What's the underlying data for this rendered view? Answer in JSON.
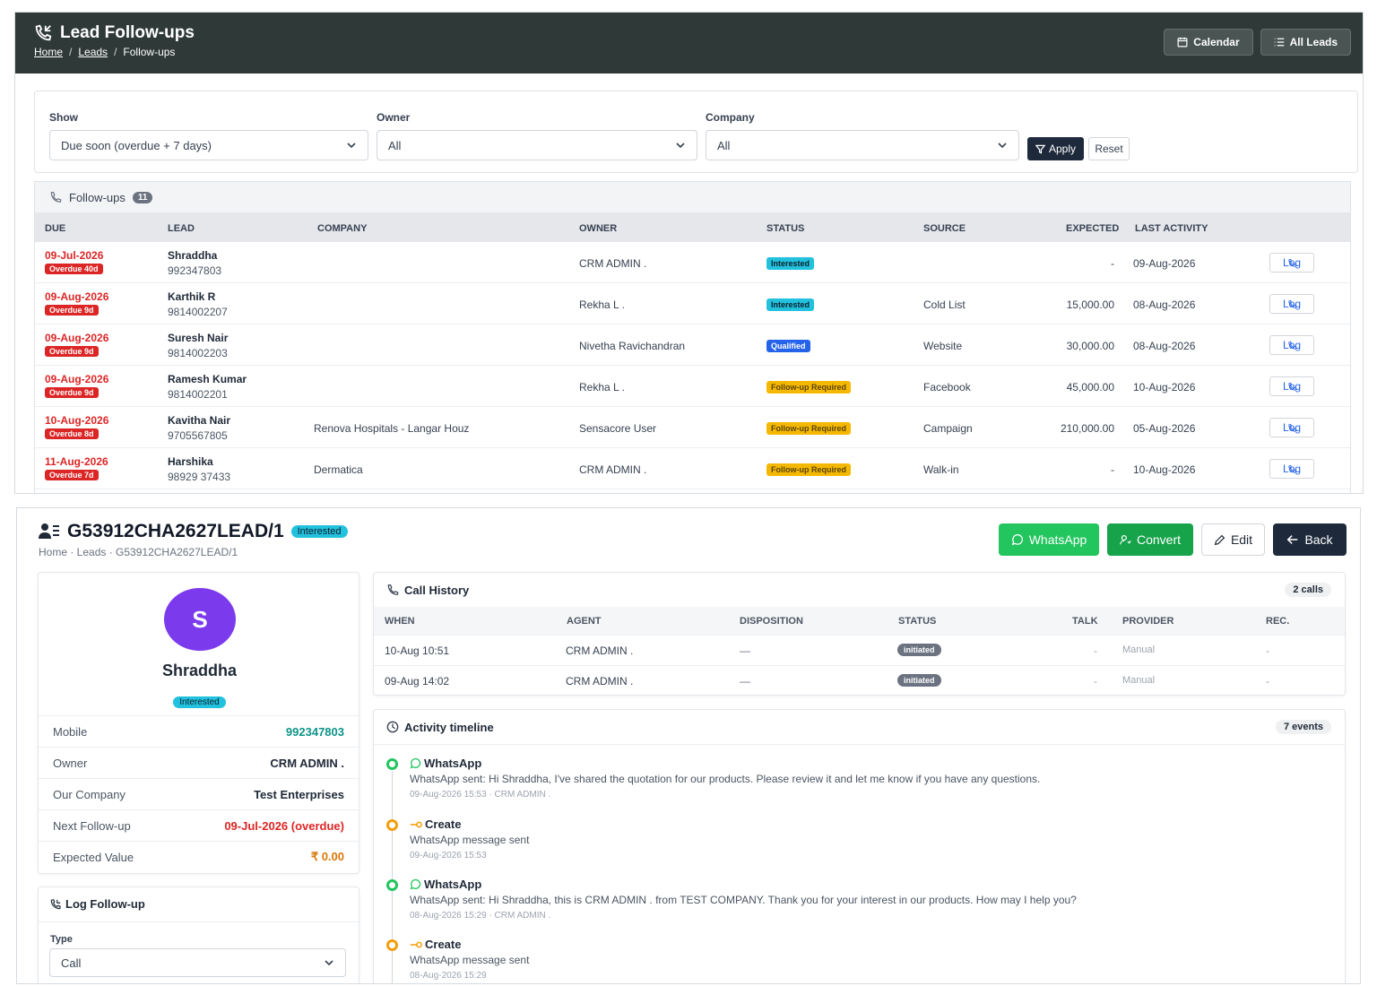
{
  "followups_page": {
    "title": "Lead Follow-ups",
    "breadcrumb": [
      "Home",
      "Leads",
      "Follow-ups"
    ],
    "calendar_label": "Calendar",
    "all_leads_label": "All Leads",
    "filters": {
      "show_label": "Show",
      "show_value": "Due soon (overdue + 7 days)",
      "owner_label": "Owner",
      "owner_value": "All",
      "company_label": "Company",
      "company_value": "All",
      "apply_label": "Apply",
      "reset_label": "Reset"
    },
    "table": {
      "title": "Follow-ups",
      "count": "11",
      "columns": [
        "DUE",
        "LEAD",
        "COMPANY",
        "OWNER",
        "STATUS",
        "SOURCE",
        "EXPECTED",
        "LAST ACTIVITY"
      ],
      "log_label": "Log",
      "rows": [
        {
          "due": "09-Jul-2026",
          "overdue": "Overdue 40d",
          "lead": "Shraddha",
          "phone": "992347803",
          "company": "",
          "owner": "CRM ADMIN .",
          "status": "Interested",
          "status_color": "#22c1dd",
          "source": "",
          "expected": "-",
          "last_activity": "09-Aug-2026"
        },
        {
          "due": "09-Aug-2026",
          "overdue": "Overdue 9d",
          "lead": "Karthik R",
          "phone": "9814002207",
          "company": "",
          "owner": "Rekha L .",
          "status": "Interested",
          "status_color": "#22c1dd",
          "source": "Cold List",
          "expected": "15,000.00",
          "last_activity": "08-Aug-2026"
        },
        {
          "due": "09-Aug-2026",
          "overdue": "Overdue 9d",
          "lead": "Suresh Nair",
          "phone": "9814002203",
          "company": "",
          "owner": "Nivetha Ravichandran",
          "status": "Qualified",
          "status_color": "#2563eb",
          "source": "Website",
          "expected": "30,000.00",
          "last_activity": "08-Aug-2026"
        },
        {
          "due": "09-Aug-2026",
          "overdue": "Overdue 9d",
          "lead": "Ramesh Kumar",
          "phone": "9814002201",
          "company": "",
          "owner": "Rekha L .",
          "status": "Follow-up Required",
          "status_color": "#f5b800",
          "source": "Facebook",
          "expected": "45,000.00",
          "last_activity": "10-Aug-2026"
        },
        {
          "due": "10-Aug-2026",
          "overdue": "Overdue 8d",
          "lead": "Kavitha Nair",
          "phone": "9705567805",
          "company": "Renova Hospitals - Langar Houz",
          "owner": "Sensacore User",
          "status": "Follow-up Required",
          "status_color": "#f5b800",
          "source": "Campaign",
          "expected": "210,000.00",
          "last_activity": "05-Aug-2026"
        },
        {
          "due": "11-Aug-2026",
          "overdue": "Overdue 7d",
          "lead": "Harshika",
          "phone": "98929 37433",
          "company": "Dermatica",
          "owner": "CRM ADMIN .",
          "status": "Follow-up Required",
          "status_color": "#f5b800",
          "source": "Walk-in",
          "expected": "-",
          "last_activity": "10-Aug-2026"
        }
      ]
    }
  },
  "lead_page": {
    "title": "G53912CHA2627LEAD/1",
    "status": "Interested",
    "breadcrumb": "Home · Leads · G53912CHA2627LEAD/1",
    "actions": {
      "whatsapp": "WhatsApp",
      "convert": "Convert",
      "edit": "Edit",
      "back": "Back"
    },
    "profile": {
      "initial": "S",
      "name": "Shraddha",
      "status": "Interested",
      "fields": [
        {
          "label": "Mobile",
          "value": "992347803"
        },
        {
          "label": "Owner",
          "value": "CRM ADMIN ."
        },
        {
          "label": "Our Company",
          "value": "Test Enterprises"
        },
        {
          "label": "Next Follow-up",
          "value": "09-Jul-2026 (overdue)"
        },
        {
          "label": "Expected Value",
          "value": "₹ 0.00"
        }
      ]
    },
    "log_followup": {
      "title": "Log Follow-up",
      "type_label": "Type",
      "type_value": "Call"
    },
    "call_history": {
      "title": "Call History",
      "count": "2 calls",
      "columns": [
        "WHEN",
        "AGENT",
        "DISPOSITION",
        "STATUS",
        "TALK",
        "PROVIDER",
        "REC."
      ],
      "rows": [
        {
          "when": "10-Aug 10:51",
          "agent": "CRM ADMIN .",
          "disposition": "—",
          "status": "initiated",
          "talk": "-",
          "provider": "Manual",
          "rec": "-"
        },
        {
          "when": "09-Aug 14:02",
          "agent": "CRM ADMIN .",
          "disposition": "—",
          "status": "initiated",
          "talk": "-",
          "provider": "Manual",
          "rec": "-"
        }
      ]
    },
    "timeline": {
      "title": "Activity timeline",
      "count": "7 events",
      "events": [
        {
          "type": "WhatsApp",
          "desc": "WhatsApp sent: Hi Shraddha, I've shared the quotation for our products. Please review it and let me know if you have any questions.",
          "meta": "09-Aug-2026 15:53 · CRM ADMIN ."
        },
        {
          "type": "Create",
          "desc": "WhatsApp message sent",
          "meta": "09-Aug-2026 15:53"
        },
        {
          "type": "WhatsApp",
          "desc": "WhatsApp sent: Hi Shraddha, this is CRM ADMIN . from TEST COMPANY. Thank you for your interest in our products. How may I help you?",
          "meta": "08-Aug-2026 15:29 · CRM ADMIN ."
        },
        {
          "type": "Create",
          "desc": "WhatsApp message sent",
          "meta": "08-Aug-2026 15:29"
        }
      ]
    }
  }
}
